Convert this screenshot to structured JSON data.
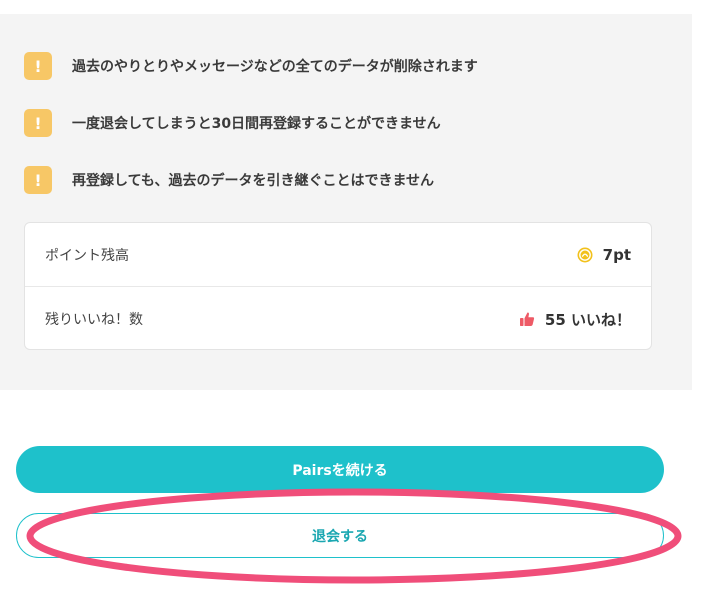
{
  "warnings": [
    {
      "icon": "!",
      "text": "過去のやりとりやメッセージなどの全てのデータが削除されます"
    },
    {
      "icon": "!",
      "text": "一度退会してしまうと30日間再登録することができません"
    },
    {
      "icon": "!",
      "text": "再登録しても、過去のデータを引き継ぐことはできません"
    }
  ],
  "info": {
    "points": {
      "label": "ポイント残高",
      "value": "7pt",
      "icon": "coin-icon"
    },
    "likes": {
      "label": "残りいいね！数",
      "value": "55 いいね！",
      "icon": "thumbs-up-icon"
    }
  },
  "actions": {
    "continue_label": "Pairsを続ける",
    "withdraw_label": "退会する"
  },
  "colors": {
    "accent": "#1ec1cb",
    "warning": "#f7c766",
    "highlight": "#f04e7a",
    "panel_bg": "#f4f4f4"
  }
}
